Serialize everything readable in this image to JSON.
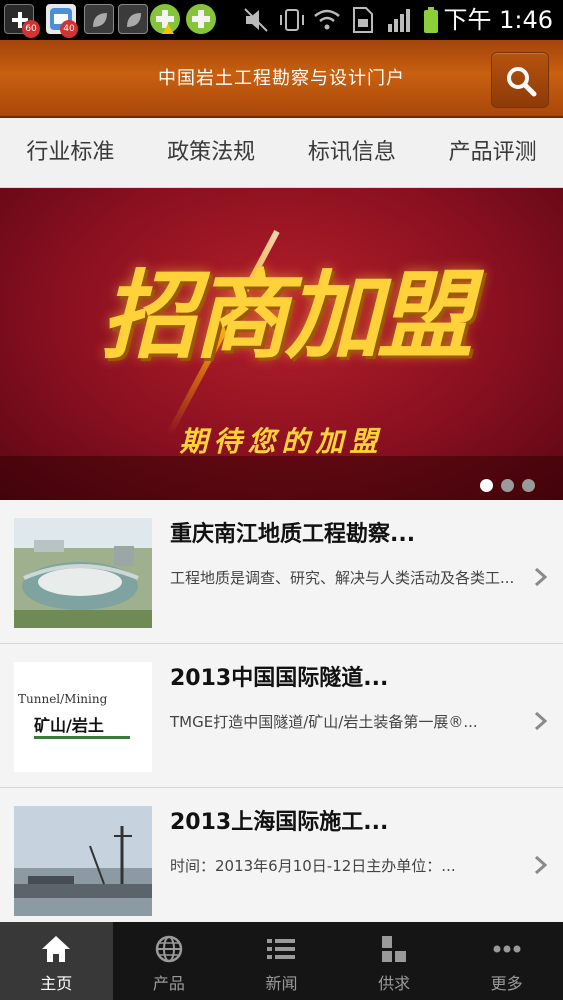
{
  "status_bar": {
    "badge_1": "60",
    "badge_2": "40",
    "time": "下午 1:46"
  },
  "header": {
    "title": "中国岩土工程勘察与设计门户",
    "search_icon": "search-icon"
  },
  "tabs": [
    {
      "label": "行业标准"
    },
    {
      "label": "政策法规"
    },
    {
      "label": "标讯信息"
    },
    {
      "label": "产品评测"
    }
  ],
  "banner": {
    "title": "招商加盟",
    "subtitle": "期待您的加盟",
    "slide_count": 3,
    "active_slide": 1
  },
  "news": [
    {
      "title": "重庆南江地质工程勘察...",
      "desc": "工程地质是调查、研究、解决与人类活动及各类工...",
      "thumb_text": ""
    },
    {
      "title": "2013中国国际隧道...",
      "desc": "TMGE打造中国隧道/矿山/岩土装备第一展®...",
      "thumb_text_1": "Tunnel/Mining",
      "thumb_text_2": "矿山/岩土"
    },
    {
      "title": "2013上海国际施工...",
      "desc": "时间：2013年6月10日-12日主办单位：..."
    }
  ],
  "bottom_nav": [
    {
      "label": "主页",
      "icon": "home-icon"
    },
    {
      "label": "产品",
      "icon": "globe-icon"
    },
    {
      "label": "新闻",
      "icon": "list-icon"
    },
    {
      "label": "供求",
      "icon": "grid-icon"
    },
    {
      "label": "更多",
      "icon": "more-icon"
    }
  ],
  "colors": {
    "header": "#c25a0e",
    "banner": "#8a1020",
    "banner_text": "#ffd23a"
  }
}
